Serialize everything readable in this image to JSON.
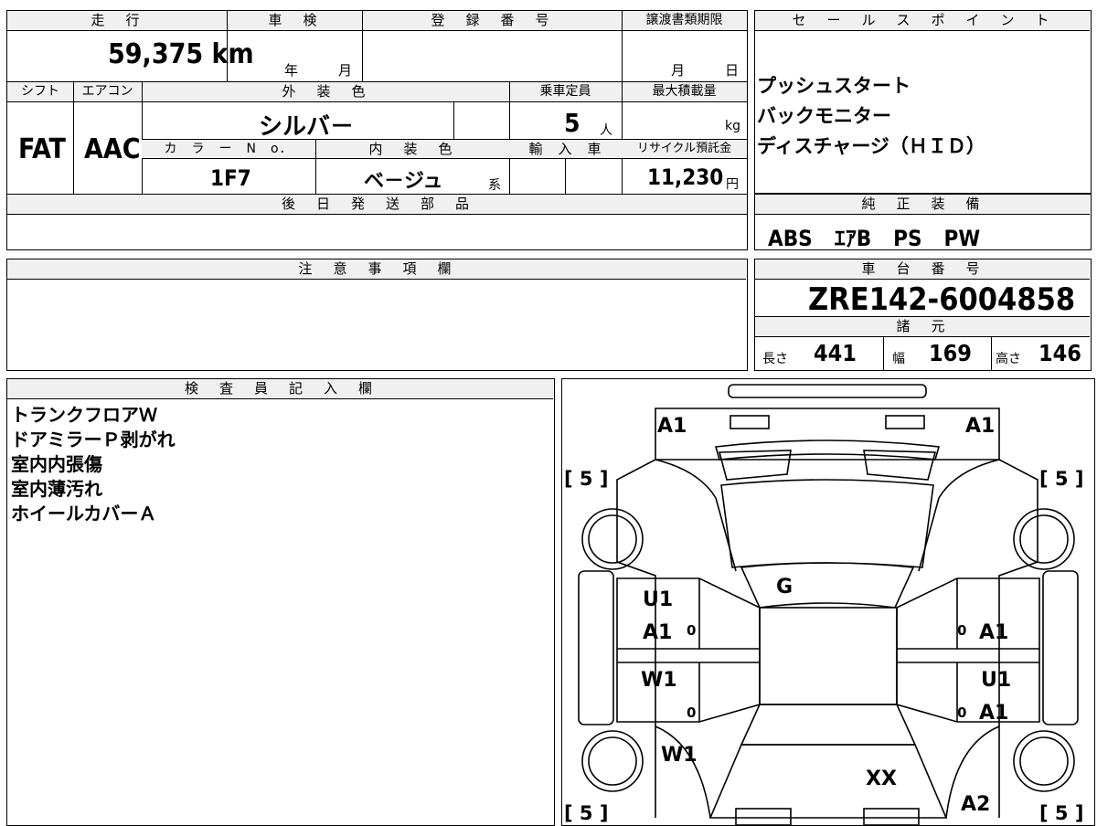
{
  "top_info": {
    "headers": {
      "mileage": "走　行",
      "inspection": "車　検",
      "registration": "登　録　番　号",
      "transfer_deadline": "譲渡書類期限",
      "shift": "シフト",
      "aircon": "エアコン",
      "exterior_color": "外　装　色",
      "capacity": "乗車定員",
      "max_load": "最大積載量",
      "color_no": "カ　ラ　ー　N　o．",
      "interior_color": "内　装　色",
      "import": "輸　入　車",
      "recycle": "リサイクル預託金"
    },
    "mileage": "59,375 km",
    "inspection_year": "年",
    "inspection_month": "月",
    "deadline_month": "月",
    "deadline_day": "日",
    "shift": "FAT",
    "aircon": "AAC",
    "exterior_color": "シルバ－",
    "capacity": "5",
    "capacity_unit": "人",
    "max_load_unit": "kg",
    "color_no": "1F7",
    "interior_color": "ベ－ジュ",
    "interior_suffix": "系",
    "recycle_fee": "11,230",
    "recycle_unit": "円",
    "later_parts_header": "後　日　発　送　部　品"
  },
  "sales_points": {
    "header": "セ　ー　ル　ス　ポ　イ　ン　ト",
    "items": [
      "プッシュスタート",
      "バックモニター",
      "ディスチャージ（ＨＩＤ）"
    ]
  },
  "standard_equipment": {
    "header": "純　正　装　備",
    "value": "ABS　ｴｱB　PS　PW"
  },
  "notes": {
    "header": "注　意　事　項　欄"
  },
  "chassis": {
    "header": "車　台　番　号",
    "number": "ZRE142-6004858",
    "spec_header": "諸　元",
    "length_label": "長さ",
    "length": "441",
    "width_label": "幅",
    "width": "169",
    "height_label": "高さ",
    "height": "146"
  },
  "inspector": {
    "header": "検　査　員　記　入　欄",
    "items": [
      "トランクフロアＷ",
      "ドアミラーＰ剥がれ",
      "室内内張傷",
      "室内薄汚れ",
      "ホイールカバーＡ"
    ]
  },
  "diagram": {
    "marks": {
      "a1_rear_left": "A1",
      "a1_rear_right": "A1",
      "tire_rear_left": "[ 5 ]",
      "tire_rear_right": "[ 5 ]",
      "tire_front_left": "[ 5 ]",
      "tire_front_right": "[ 5 ]",
      "g_glass": "G",
      "u1_left": "U1",
      "a1_left_rear_door": "A1",
      "zero_1": "0",
      "w1_left_front_door": "W1",
      "zero_2": "0",
      "w1_left_fender": "W1",
      "zero_3": "0",
      "a1_right_rear_door": "A1",
      "u1_right": "U1",
      "zero_4": "0",
      "a1_right_front_door": "A1",
      "xx_hood": "XX",
      "a2_right_front": "A2"
    }
  }
}
